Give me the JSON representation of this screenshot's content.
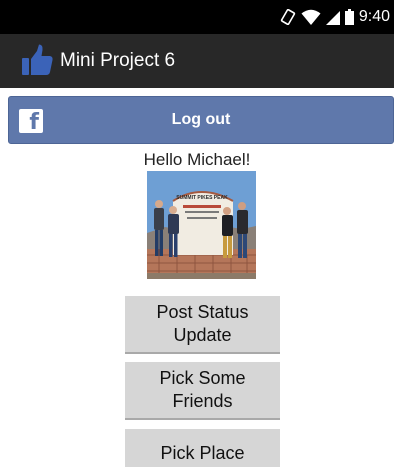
{
  "status_bar": {
    "time": "9:40",
    "icons": [
      "vibrate-icon",
      "wifi-icon",
      "signal-icon",
      "battery-icon"
    ]
  },
  "app_bar": {
    "title": "Mini Project 6",
    "icon": "thumbs-up-icon",
    "icon_color": "#3b63b8"
  },
  "facebook_button": {
    "label": "Log out",
    "icon": "facebook-icon",
    "background": "#5f78ab"
  },
  "profile": {
    "greeting": "Hello Michael!",
    "photo_sign_text": "SUMMIT PIKES PEAK"
  },
  "actions": {
    "post_status": "Post Status Update",
    "pick_friends": "Pick Some Friends",
    "pick_place": "Pick Place"
  }
}
